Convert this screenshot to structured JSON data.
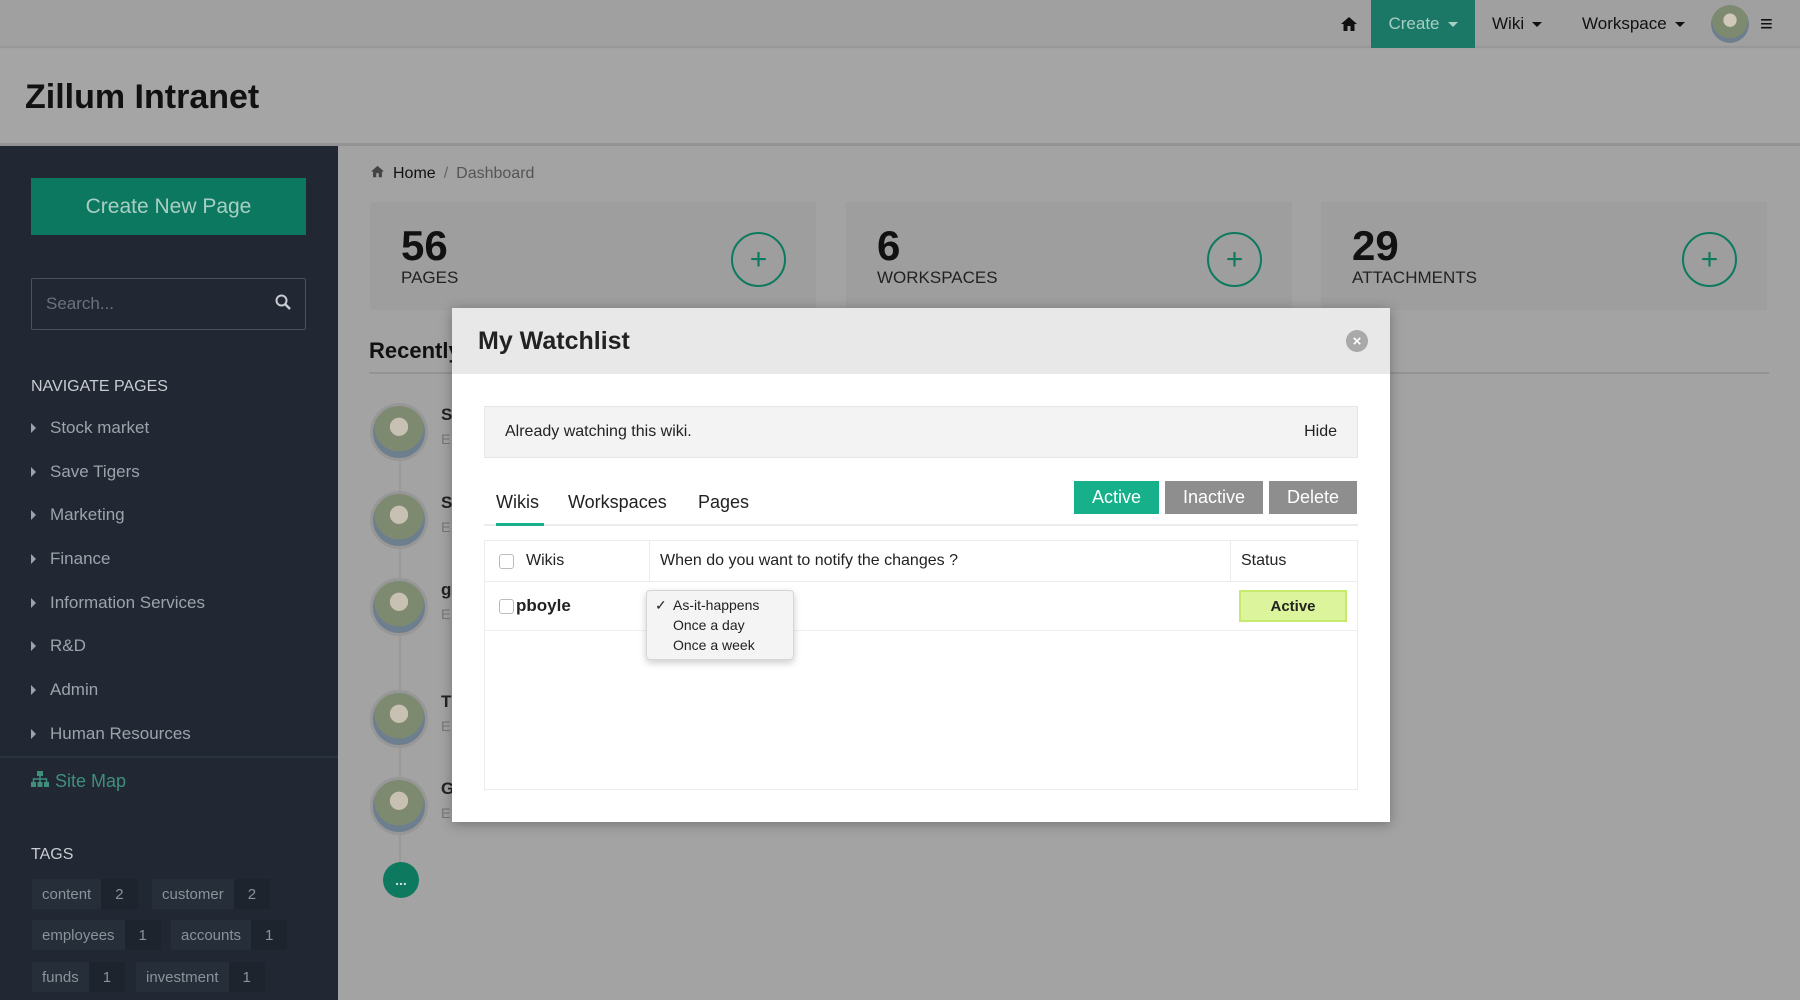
{
  "topbar": {
    "create": "Create",
    "wiki": "Wiki",
    "workspace": "Workspace"
  },
  "app": {
    "title": "Zillum Intranet"
  },
  "sidebar": {
    "create_button": "Create New Page",
    "search_placeholder": "Search...",
    "nav_heading": "NAVIGATE PAGES",
    "items": [
      "Stock market",
      "Save Tigers",
      "Marketing",
      "Finance",
      "Information Services",
      "R&D",
      "Admin",
      "Human Resources"
    ],
    "site_map": "Site Map",
    "tags_heading": "TAGS",
    "tags": [
      {
        "name": "content",
        "count": "2"
      },
      {
        "name": "customer",
        "count": "2"
      },
      {
        "name": "employees",
        "count": "1"
      },
      {
        "name": "accounts",
        "count": "1"
      },
      {
        "name": "funds",
        "count": "1"
      },
      {
        "name": "investment",
        "count": "1"
      }
    ]
  },
  "breadcrumb": {
    "home": "Home",
    "sep": "/",
    "current": "Dashboard"
  },
  "stats": [
    {
      "value": "56",
      "label": "PAGES"
    },
    {
      "value": "6",
      "label": "WORKSPACES"
    },
    {
      "value": "29",
      "label": "ATTACHMENTS"
    }
  ],
  "recent": {
    "heading": "Recently",
    "items": [
      {
        "t": "S",
        "s": "E"
      },
      {
        "t": "S",
        "s": "E"
      },
      {
        "t": "g",
        "s": "E"
      },
      {
        "t": "T",
        "s": "E"
      },
      {
        "t": "G",
        "s": "E"
      }
    ],
    "more": "..."
  },
  "modal": {
    "title": "My Watchlist",
    "alert": "Already watching this wiki.",
    "hide": "Hide",
    "tabs": [
      "Wikis",
      "Workspaces",
      "Pages"
    ],
    "buttons": {
      "active": "Active",
      "inactive": "Inactive",
      "delete": "Delete"
    },
    "columns": [
      "Wikis",
      "When do you want to notify the changes ?",
      "Status"
    ],
    "row": {
      "name": "pboyle",
      "status": "Active"
    },
    "options": [
      "As-it-happens",
      "Once a day",
      "Once a week"
    ],
    "selected_check": "✓"
  },
  "colors": {
    "accent": "#16b08a",
    "brand_dark": "#0c7860",
    "sidebar": "#212833"
  }
}
